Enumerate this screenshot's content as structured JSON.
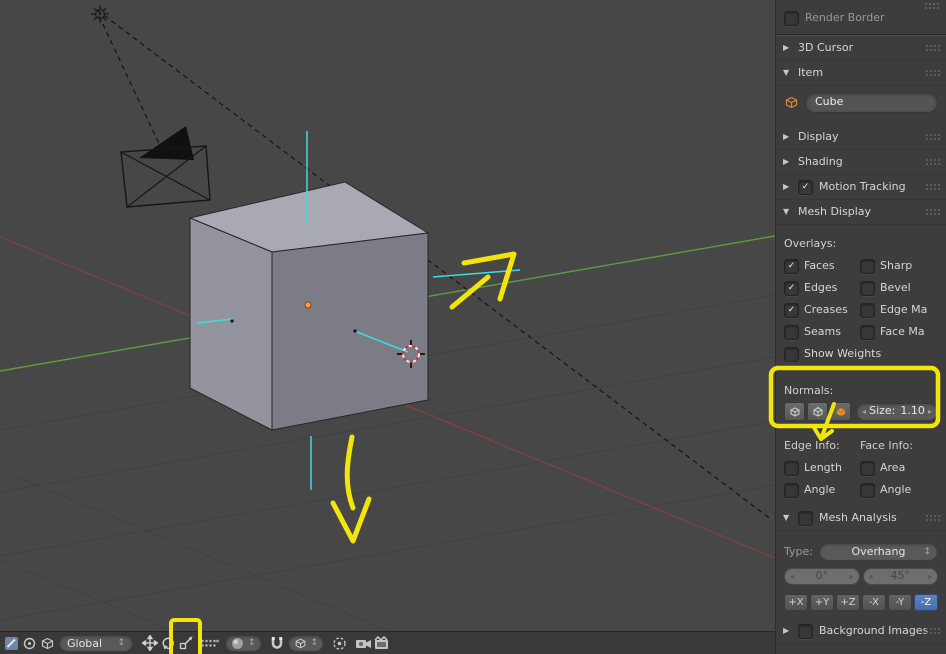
{
  "icons": {
    "collapsed": "▶",
    "expanded": "▼",
    "check": "✓",
    "dropdown_arrows": "↕",
    "stepper_left": "◂",
    "stepper_right": "▸"
  },
  "colors": {
    "annotation_yellow": "#f2e50b",
    "axis_green": "#5f9c3f",
    "axis_red": "#8f4040",
    "normals_cyan": "#3adde0",
    "active_blue": "#5680c2",
    "origin_orange": "#ff9d45"
  },
  "header": {
    "orientation_value": "Global",
    "icon_names": [
      "editor-type",
      "pivot-point",
      "mode",
      "manipulator-translate",
      "manipulator-rotate",
      "manipulator-scale",
      "layers",
      "draw-mode",
      "snap-magnet",
      "snap-element",
      "snap-target",
      "opengl-render",
      "opengl-render-anim"
    ]
  },
  "sidebar": {
    "render_border": {
      "label": "Render Border",
      "checked": false
    },
    "cursor_panel": {
      "label": "3D Cursor"
    },
    "item_panel": {
      "label": "Item",
      "name_value": "Cube"
    },
    "display_panel": {
      "label": "Display"
    },
    "shading_panel": {
      "label": "Shading"
    },
    "motion_tracking_panel": {
      "label": "Motion Tracking",
      "checked": true
    },
    "mesh_display": {
      "label": "Mesh Display",
      "overlays_label": "Overlays:",
      "overlays": [
        {
          "label": "Faces",
          "checked": true
        },
        {
          "label": "Sharp",
          "checked": false
        },
        {
          "label": "Edges",
          "checked": true
        },
        {
          "label": "Bevel",
          "checked": false
        },
        {
          "label": "Creases",
          "checked": true
        },
        {
          "label": "Edge Ma",
          "checked": false
        },
        {
          "label": "Seams",
          "checked": false
        },
        {
          "label": "Face Ma",
          "checked": false
        },
        {
          "label": "Show Weights",
          "checked": false
        }
      ],
      "normals_label": "Normals:",
      "size_label": "Size:",
      "size_value": "1.10",
      "edge_info_label": "Edge Info:",
      "face_info_label": "Face Info:",
      "edge_length": {
        "label": "Length",
        "checked": false
      },
      "edge_angle": {
        "label": "Angle",
        "checked": false
      },
      "face_area": {
        "label": "Area",
        "checked": false
      },
      "face_angle": {
        "label": "Angle",
        "checked": false
      }
    },
    "mesh_analysis": {
      "label": "Mesh Analysis",
      "checked": false,
      "type_label": "Type:",
      "type_value": "Overhang",
      "min_value": "0°",
      "max_value": "45°",
      "axes": [
        "+X",
        "+Y",
        "+Z",
        "-X",
        "-Y",
        "-Z"
      ],
      "active_axis": "-Z"
    },
    "background_images_panel": {
      "label": "Background Images",
      "checked": false
    }
  },
  "viewport": {
    "objects": [
      "Cube",
      "Camera"
    ],
    "annotations": [
      "highlight-box-normals-panel",
      "arrow-to-axis",
      "arrow-down",
      "highlight-box-manipulator-icons"
    ]
  }
}
